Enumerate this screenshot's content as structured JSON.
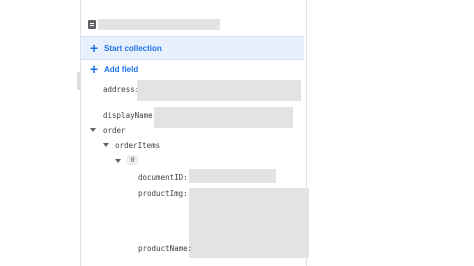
{
  "document": {
    "icon": "document-icon"
  },
  "actions": {
    "start_collection": "Start collection",
    "add_field": "Add field"
  },
  "fields": {
    "address": "address:",
    "displayName": "displayName:",
    "order": "order",
    "orderItems": "orderItems",
    "index0": "0",
    "documentID": "documentID:",
    "productImg": "productImg:",
    "productName": "productName:"
  },
  "colors": {
    "accent": "#1a73e8",
    "highlight_bg": "#e8f0fe",
    "redaction": "#e4e2e2"
  }
}
